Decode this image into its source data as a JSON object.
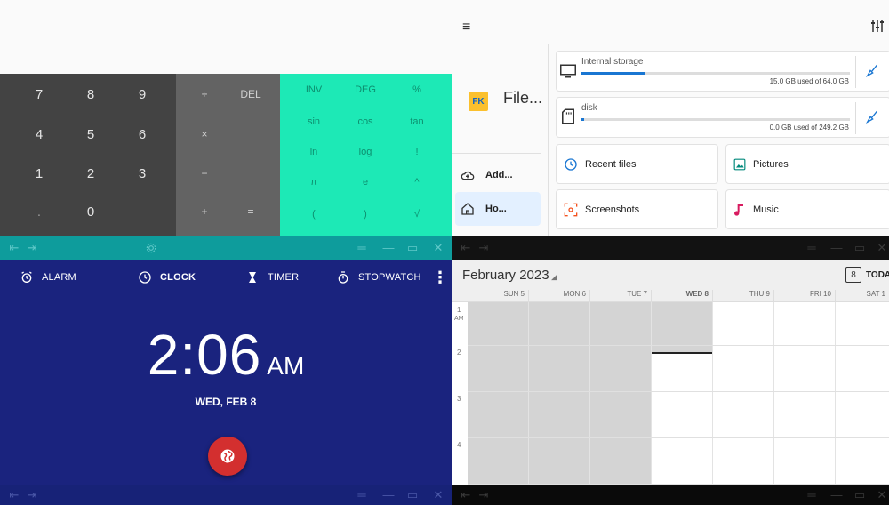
{
  "calculator": {
    "num_keys": [
      "7",
      "8",
      "9",
      "4",
      "5",
      "6",
      "1",
      "2",
      "3",
      ".",
      "0"
    ],
    "op_keys": [
      "÷",
      "DEL",
      "×",
      "−",
      "+",
      "="
    ],
    "adv_keys": [
      "INV",
      "DEG",
      "%",
      "sin",
      "cos",
      "tan",
      "ln",
      "log",
      "!",
      "π",
      "e",
      "^",
      "(",
      ")",
      "√"
    ]
  },
  "clock": {
    "tabs": {
      "alarm": "ALARM",
      "clock": "CLOCK",
      "timer": "TIMER",
      "stopwatch": "STOPWATCH"
    },
    "time": "2:06",
    "ampm": "AM",
    "date": "WED, FEB 8"
  },
  "files": {
    "app_title": "File...",
    "drawer": {
      "add": "Add...",
      "home": "Ho..."
    },
    "storage": [
      {
        "title": "Internal storage",
        "used": "15.0 GB used of 64.0 GB",
        "fraction": 0.234
      },
      {
        "title": "disk",
        "used": "0.0 GB used of 249.2 GB",
        "fraction": 0.0
      }
    ],
    "tiles": {
      "recent": "Recent files",
      "pictures": "Pictures",
      "screenshots": "Screenshots",
      "music": "Music"
    }
  },
  "calendar": {
    "month": "February 2023",
    "today_label": "TODAY",
    "today_num": "8",
    "days": [
      "SUN 5",
      "MON 6",
      "TUE 7",
      "WED 8",
      "THU 9",
      "FRI 10",
      "SAT 1"
    ],
    "hours": [
      "1",
      "2",
      "3",
      "4"
    ],
    "first_hour_suffix": "AM"
  },
  "colors": {
    "calc_accent": "#1de9b6",
    "clock_bg": "#1a237e",
    "fab": "#d32f2f",
    "storage_bar": "#1976d2",
    "files_logo": "#fbc02d"
  }
}
